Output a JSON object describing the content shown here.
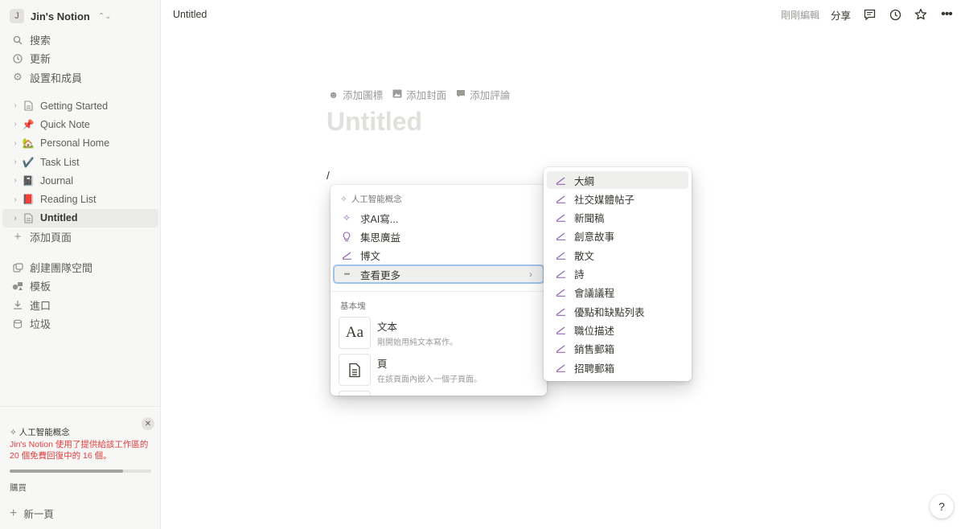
{
  "workspace": {
    "initial": "J",
    "name": "Jin's Notion"
  },
  "sidebar": {
    "nav": [
      {
        "label": "搜索",
        "icon": "search-icon"
      },
      {
        "label": "更新",
        "icon": "clock-icon"
      },
      {
        "label": "設置和成員",
        "icon": "gear-icon"
      }
    ],
    "pages": [
      {
        "label": "Getting Started",
        "icon": "page-icon",
        "emoji": ""
      },
      {
        "label": "Quick Note",
        "icon": "pushpin-icon",
        "emoji": "📌"
      },
      {
        "label": "Personal Home",
        "icon": "house-icon",
        "emoji": "🏡"
      },
      {
        "label": "Task List",
        "icon": "checkmark-icon",
        "emoji": "✔️"
      },
      {
        "label": "Journal",
        "icon": "notebook-icon",
        "emoji": "📓"
      },
      {
        "label": "Reading List",
        "icon": "book-icon",
        "emoji": "📕"
      },
      {
        "label": "Untitled",
        "icon": "page-icon",
        "emoji": ""
      }
    ],
    "add_page": "添加頁面",
    "tools": [
      {
        "label": "創建團隊空間",
        "icon": "teamspace-icon"
      },
      {
        "label": "模板",
        "icon": "template-icon"
      },
      {
        "label": "進口",
        "icon": "import-icon"
      },
      {
        "label": "垃圾",
        "icon": "trash-icon"
      }
    ],
    "ai_card": {
      "title": "人工智能概念",
      "message": "Jin's Notion 使用了提供給該工作區的 20 個免費回復中的 16 個。",
      "used": 16,
      "total": 20,
      "buy": "購買"
    },
    "new_page": "新一頁"
  },
  "topbar": {
    "title": "Untitled",
    "edited": "剛剛編輯",
    "share": "分享"
  },
  "page": {
    "actions": [
      "添加圖標",
      "添加封面",
      "添加評論"
    ],
    "title_placeholder": "Untitled",
    "typed": "/"
  },
  "menu": {
    "ai_section": "人工智能概念",
    "ai_items": [
      {
        "label": "求AI寫...",
        "icon": "sparkle-icon"
      },
      {
        "label": "集思廣益",
        "icon": "lightbulb-icon"
      },
      {
        "label": "博文",
        "icon": "pen-icon"
      },
      {
        "label": "查看更多",
        "icon": "more-icon"
      }
    ],
    "basic_section": "基本塊",
    "blocks": [
      {
        "title": "文本",
        "desc": "剛開始用純文本寫作。",
        "thumb": "Aa"
      },
      {
        "title": "頁",
        "desc": "在該頁面內嵌入一個子頁面。",
        "thumb": ""
      }
    ]
  },
  "submenu": {
    "items": [
      "大綱",
      "社交媒體帖子",
      "新聞稿",
      "創意故事",
      "散文",
      "詩",
      "會議議程",
      "優點和缺點列表",
      "職位描述",
      "銷售郵箱",
      "招聘郵箱"
    ]
  },
  "help": "?",
  "colors": {
    "accent_purple": "#9065b0",
    "warning_red": "#e03e3e",
    "selection_blue": "#9ec3ef"
  }
}
